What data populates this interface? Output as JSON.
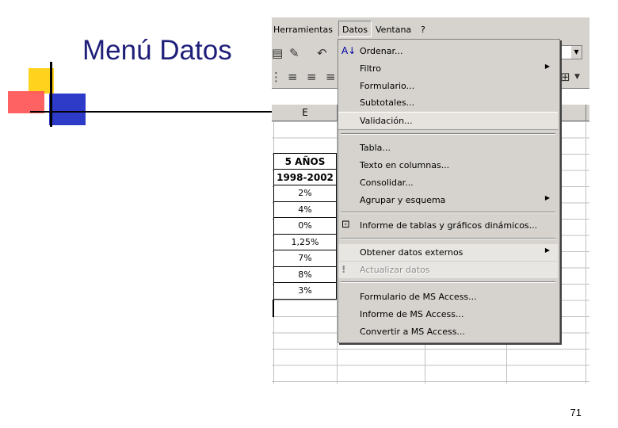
{
  "slide": {
    "title": "Menú Datos",
    "page_number": "71"
  },
  "menubar": {
    "items": [
      {
        "label": "Herramientas"
      },
      {
        "label": "Datos"
      },
      {
        "label": "Ventana"
      },
      {
        "label": "?"
      }
    ]
  },
  "column_header": {
    "label": "E"
  },
  "cells": [
    "5 AÑOS",
    "1998-2002",
    "2%",
    "4%",
    "0%",
    "1,25%",
    "7%",
    "8%",
    "3%"
  ],
  "data_menu": {
    "items": [
      {
        "label": "Ordenar...",
        "icon": "sort-az-icon"
      },
      {
        "label": "Filtro",
        "submenu": true
      },
      {
        "label": "Formulario..."
      },
      {
        "label": "Subtotales..."
      },
      {
        "label": "Validación..."
      },
      {
        "label": "Tabla..."
      },
      {
        "label": "Texto en columnas..."
      },
      {
        "label": "Consolidar..."
      },
      {
        "label": "Agrupar y esquema",
        "submenu": true
      },
      {
        "label": "Informe de tablas y gráficos dinámicos...",
        "icon": "pivot-table-icon"
      },
      {
        "label": "Obtener datos externos",
        "submenu": true
      },
      {
        "label": "Actualizar datos",
        "icon": "refresh-exclamation-icon",
        "disabled": true
      },
      {
        "label": "Formulario de MS Access..."
      },
      {
        "label": "Informe de MS Access..."
      },
      {
        "label": "Convertir a MS Access..."
      }
    ]
  }
}
